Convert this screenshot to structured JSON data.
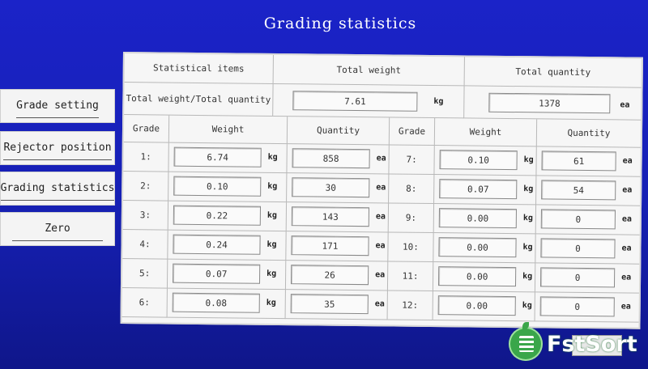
{
  "title": "Grading statistics",
  "sidebar": {
    "items": [
      {
        "label": "Grade setting"
      },
      {
        "label": "Rejector position"
      },
      {
        "label": "Grading statistics"
      },
      {
        "label": "Zero"
      }
    ]
  },
  "summary": {
    "items_header": "Statistical items",
    "weight_header": "Total weight",
    "quantity_header": "Total quantity",
    "row_label": "Total weight/Total quantity",
    "total_weight": "7.61",
    "total_weight_unit": "kg",
    "total_quantity": "1378",
    "total_quantity_unit": "ea"
  },
  "grid": {
    "headers": {
      "grade": "Grade",
      "weight": "Weight",
      "quantity": "Quantity"
    },
    "weight_unit": "kg",
    "quantity_unit": "ea",
    "left": [
      {
        "grade": "1:",
        "weight": "6.74",
        "quantity": "858"
      },
      {
        "grade": "2:",
        "weight": "0.10",
        "quantity": "30"
      },
      {
        "grade": "3:",
        "weight": "0.22",
        "quantity": "143"
      },
      {
        "grade": "4:",
        "weight": "0.24",
        "quantity": "171"
      },
      {
        "grade": "5:",
        "weight": "0.07",
        "quantity": "26"
      },
      {
        "grade": "6:",
        "weight": "0.08",
        "quantity": "35"
      }
    ],
    "right": [
      {
        "grade": "7:",
        "weight": "0.10",
        "quantity": "61"
      },
      {
        "grade": "8:",
        "weight": "0.07",
        "quantity": "54"
      },
      {
        "grade": "9:",
        "weight": "0.00",
        "quantity": "0"
      },
      {
        "grade": "10:",
        "weight": "0.00",
        "quantity": "0"
      },
      {
        "grade": "11:",
        "weight": "0.00",
        "quantity": "0"
      },
      {
        "grade": "12:",
        "weight": "0.00",
        "quantity": "0"
      }
    ]
  },
  "logo": {
    "text": "FstSort",
    "color": "#3aa64a"
  }
}
